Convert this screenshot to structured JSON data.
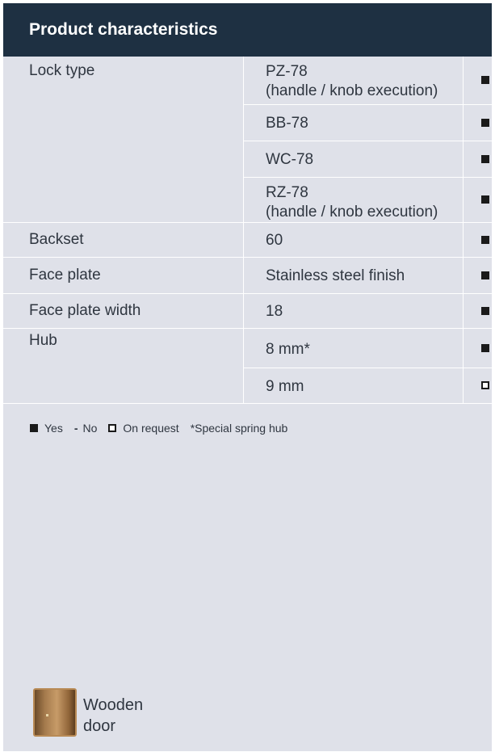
{
  "header": {
    "title": "Product characteristics"
  },
  "rows": [
    {
      "prop": "Lock type",
      "val_line1": "PZ-78",
      "val_line2": "(handle / knob execution)",
      "mark": "filled"
    },
    {
      "val": "BB-78",
      "mark": "filled"
    },
    {
      "val": "WC-78",
      "mark": "filled"
    },
    {
      "val_line1": "RZ-78",
      "val_line2": "(handle / knob execution)",
      "mark": "filled"
    },
    {
      "prop": "Backset",
      "val": "60",
      "mark": "filled"
    },
    {
      "prop": "Face plate",
      "val": "Stainless steel finish",
      "mark": "filled"
    },
    {
      "prop": "Face plate width",
      "val": "18",
      "mark": "filled"
    },
    {
      "prop": "Hub",
      "val": "8 mm*",
      "mark": "filled"
    },
    {
      "val": "9 mm",
      "mark": "open"
    }
  ],
  "legend": {
    "yes": "Yes",
    "no_symbol": "-",
    "no": "No",
    "on_request": "On request",
    "special": "*Special spring hub"
  },
  "door": {
    "line1": "Wooden",
    "line2": "door"
  }
}
